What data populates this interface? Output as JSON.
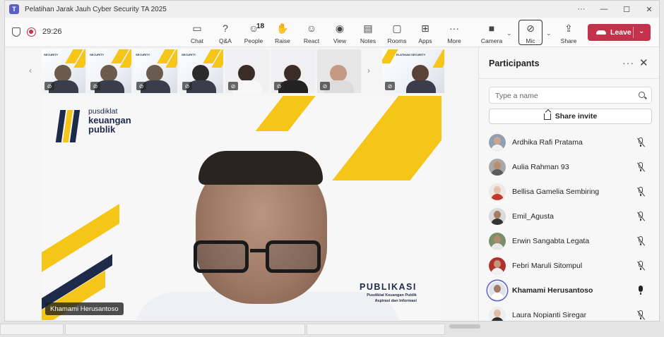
{
  "window": {
    "title": "Pelatihan Jarak Jauh Cyber Security TA 2025",
    "controls": {
      "more": "···",
      "minimize": "—",
      "maximize": "☐",
      "close": "✕"
    }
  },
  "toolbar": {
    "timer": "29:26",
    "tools": [
      {
        "name": "chat",
        "label": "Chat",
        "icon": "chat-icon"
      },
      {
        "name": "qa",
        "label": "Q&A",
        "icon": "qa-icon"
      },
      {
        "name": "people",
        "label": "People",
        "icon": "people-icon",
        "count": "18"
      },
      {
        "name": "raise",
        "label": "Raise",
        "icon": "hand-icon"
      },
      {
        "name": "react",
        "label": "React",
        "icon": "smile-icon"
      },
      {
        "name": "view",
        "label": "View",
        "icon": "view-icon"
      },
      {
        "name": "notes",
        "label": "Notes",
        "icon": "notes-icon"
      },
      {
        "name": "rooms",
        "label": "Rooms",
        "icon": "rooms-icon"
      },
      {
        "name": "apps",
        "label": "Apps",
        "icon": "plus-icon"
      },
      {
        "name": "more",
        "label": "More",
        "icon": "ellipsis-icon"
      },
      {
        "name": "camera",
        "label": "Camera",
        "icon": "camera-icon"
      },
      {
        "name": "mic",
        "label": "Mic",
        "icon": "mic-off-icon"
      },
      {
        "name": "share",
        "label": "Share",
        "icon": "share-icon"
      }
    ],
    "leave_label": "Leave",
    "colors": {
      "leave": "#c4314b",
      "accent": "#5b5fc7"
    }
  },
  "slide": {
    "logo_line1": "pusdiklat",
    "logo_line2": "keuangan",
    "logo_line3": "publik",
    "publikasi_title": "PUBLIKASI",
    "publikasi_sub1": "Pusdiklat Keuangan Publik",
    "publikasi_sub2": "Aspirasi dan Informasi",
    "tile_label": "SECURITY",
    "tile_label_alt": "ELATIHAN SECURITY",
    "colors": {
      "yellow": "#f5c518",
      "navy": "#1e2a4a"
    }
  },
  "presenter": {
    "name": "Khamami Herusantoso"
  },
  "participants_panel": {
    "title": "Participants",
    "search_placeholder": "Type a name",
    "share_invite_label": "Share invite",
    "people": [
      {
        "name": "Ardhika Rafi Pratama",
        "muted": true
      },
      {
        "name": "Aulia Rahman 93",
        "muted": true
      },
      {
        "name": "Bellisa Gamelia Sembiring",
        "muted": true
      },
      {
        "name": "Emil_Agusta",
        "muted": true
      },
      {
        "name": "Erwin Sangabta Legata",
        "muted": true
      },
      {
        "name": "Febri Maruli Sitompul",
        "muted": true
      },
      {
        "name": "Khamami Herusantoso",
        "muted": false
      },
      {
        "name": "Laura Nopianti Siregar",
        "muted": true
      }
    ]
  }
}
